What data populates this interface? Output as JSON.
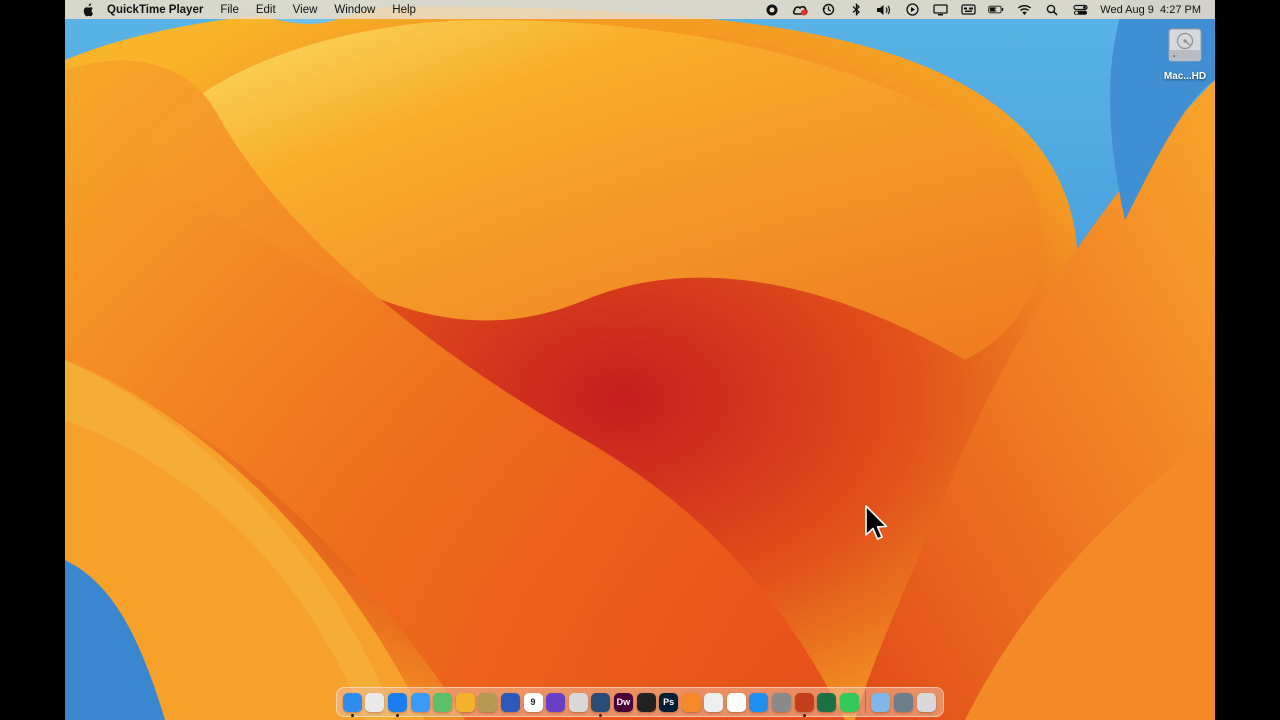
{
  "menubar": {
    "app_name": "QuickTime Player",
    "menus": [
      "File",
      "Edit",
      "View",
      "Window",
      "Help"
    ],
    "status_icons": [
      "screen-record-icon",
      "creative-cloud-icon",
      "time-machine-icon",
      "bluetooth-icon",
      "volume-icon",
      "play-icon",
      "display-icon",
      "keyboard-icon",
      "battery-icon",
      "wifi-icon",
      "spotlight-search-icon",
      "control-center-icon"
    ],
    "clock": {
      "date": "Wed Aug 9",
      "time": "4:27 PM"
    }
  },
  "desktop": {
    "drive_label": "Mac...HD"
  },
  "dock": {
    "apps": [
      {
        "name": "finder-icon",
        "color": "#2e8cf0",
        "running": true
      },
      {
        "name": "launchpad-icon",
        "color": "#e9e9e9",
        "running": false
      },
      {
        "name": "safari-icon",
        "color": "#1a7ef2",
        "running": true
      },
      {
        "name": "mail-icon",
        "color": "#3b9af5",
        "running": false
      },
      {
        "name": "maps-icon",
        "color": "#5cc06a",
        "running": false
      },
      {
        "name": "photos-icon",
        "color": "#f3b12c",
        "running": false
      },
      {
        "name": "notes-icon",
        "color": "#b79a52",
        "running": false
      },
      {
        "name": "word-icon",
        "color": "#2b5ab8",
        "running": false
      },
      {
        "name": "calendar-icon",
        "color": "#ffffff",
        "running": false,
        "text": "9"
      },
      {
        "name": "imovie-icon",
        "color": "#6a3fc8",
        "running": false
      },
      {
        "name": "screenshot-icon",
        "color": "#d8d8d8",
        "running": false
      },
      {
        "name": "quicktime-icon",
        "color": "#2a4d78",
        "running": true
      },
      {
        "name": "dreamweaver-icon",
        "color": "#470137",
        "running": false,
        "text": "Dw"
      },
      {
        "name": "final-cut-icon",
        "color": "#222222",
        "running": false
      },
      {
        "name": "photoshop-icon",
        "color": "#001e36",
        "running": false,
        "text": "Ps"
      },
      {
        "name": "books-icon",
        "color": "#f58a2a",
        "running": false
      },
      {
        "name": "preview-icon",
        "color": "#eeeeee",
        "running": false
      },
      {
        "name": "freeform-icon",
        "color": "#ffffff",
        "running": false
      },
      {
        "name": "app-store-icon",
        "color": "#1f8ef1",
        "running": false
      },
      {
        "name": "system-settings-icon",
        "color": "#8a8a8a",
        "running": false
      },
      {
        "name": "powerpoint-icon",
        "color": "#c43e1c",
        "running": true
      },
      {
        "name": "excel-icon",
        "color": "#1d7044",
        "running": false
      },
      {
        "name": "messages-icon",
        "color": "#34c759",
        "running": false
      }
    ],
    "stacks": [
      {
        "name": "folder-icon",
        "color": "#7fb8e6"
      },
      {
        "name": "downloads-icon",
        "color": "#6e7d8c"
      },
      {
        "name": "trash-icon",
        "color": "#d9d9d9"
      }
    ]
  }
}
